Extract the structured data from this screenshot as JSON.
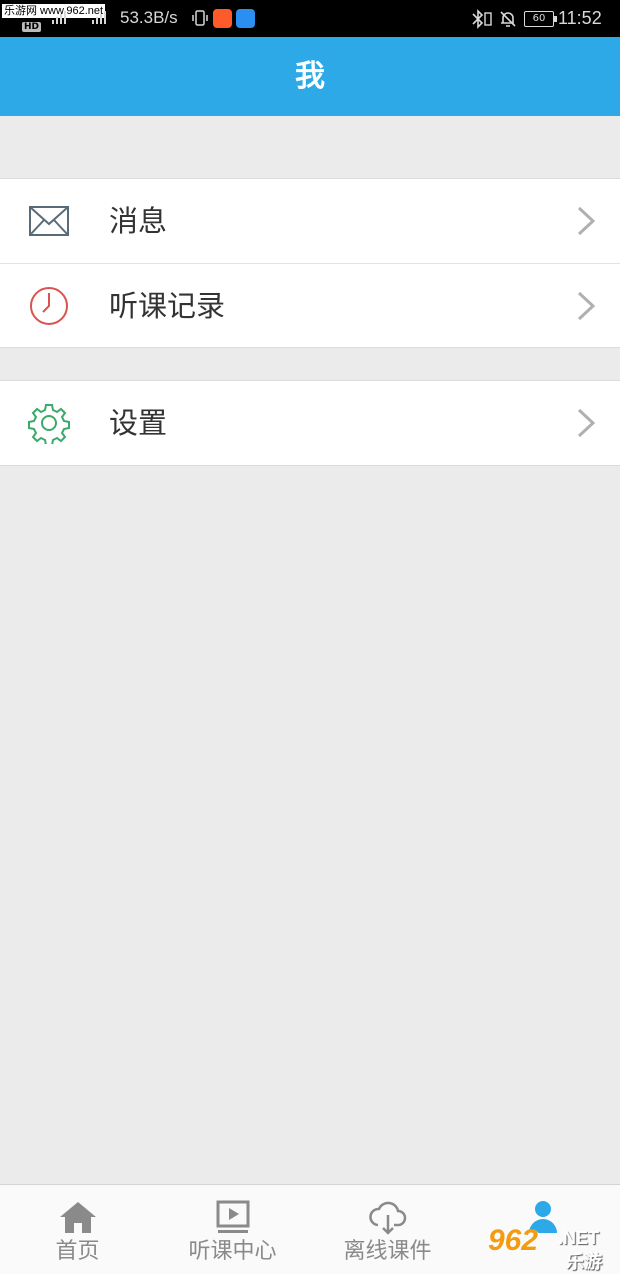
{
  "status_bar": {
    "watermark_text": "乐游网 www.962.net",
    "network_badge": "HD",
    "net_speed": "53.3B/s",
    "battery": "60",
    "time": "11:52"
  },
  "header": {
    "title": "我"
  },
  "menu_groups": [
    {
      "items": [
        {
          "label": "消息",
          "icon": "mail-icon",
          "icon_color": "#5a6b78"
        },
        {
          "label": "听课记录",
          "icon": "clock-icon",
          "icon_color": "#d9534f"
        }
      ]
    },
    {
      "items": [
        {
          "label": "设置",
          "icon": "gear-icon",
          "icon_color": "#3aaa6a"
        }
      ]
    }
  ],
  "bottom_nav": {
    "items": [
      {
        "label": "首页",
        "icon": "home-icon",
        "active": false
      },
      {
        "label": "听课中心",
        "icon": "video-icon",
        "active": false
      },
      {
        "label": "离线课件",
        "icon": "cloud-download-icon",
        "active": false
      },
      {
        "label": "",
        "icon": "profile-icon",
        "active": true
      }
    ]
  },
  "corner_watermark": {
    "number": "962",
    "suffix": ".NET",
    "cn": "乐游网"
  },
  "colors": {
    "accent": "#2ea9e8",
    "background": "#ebebeb",
    "text": "#333333",
    "muted": "#8a8a8a"
  }
}
